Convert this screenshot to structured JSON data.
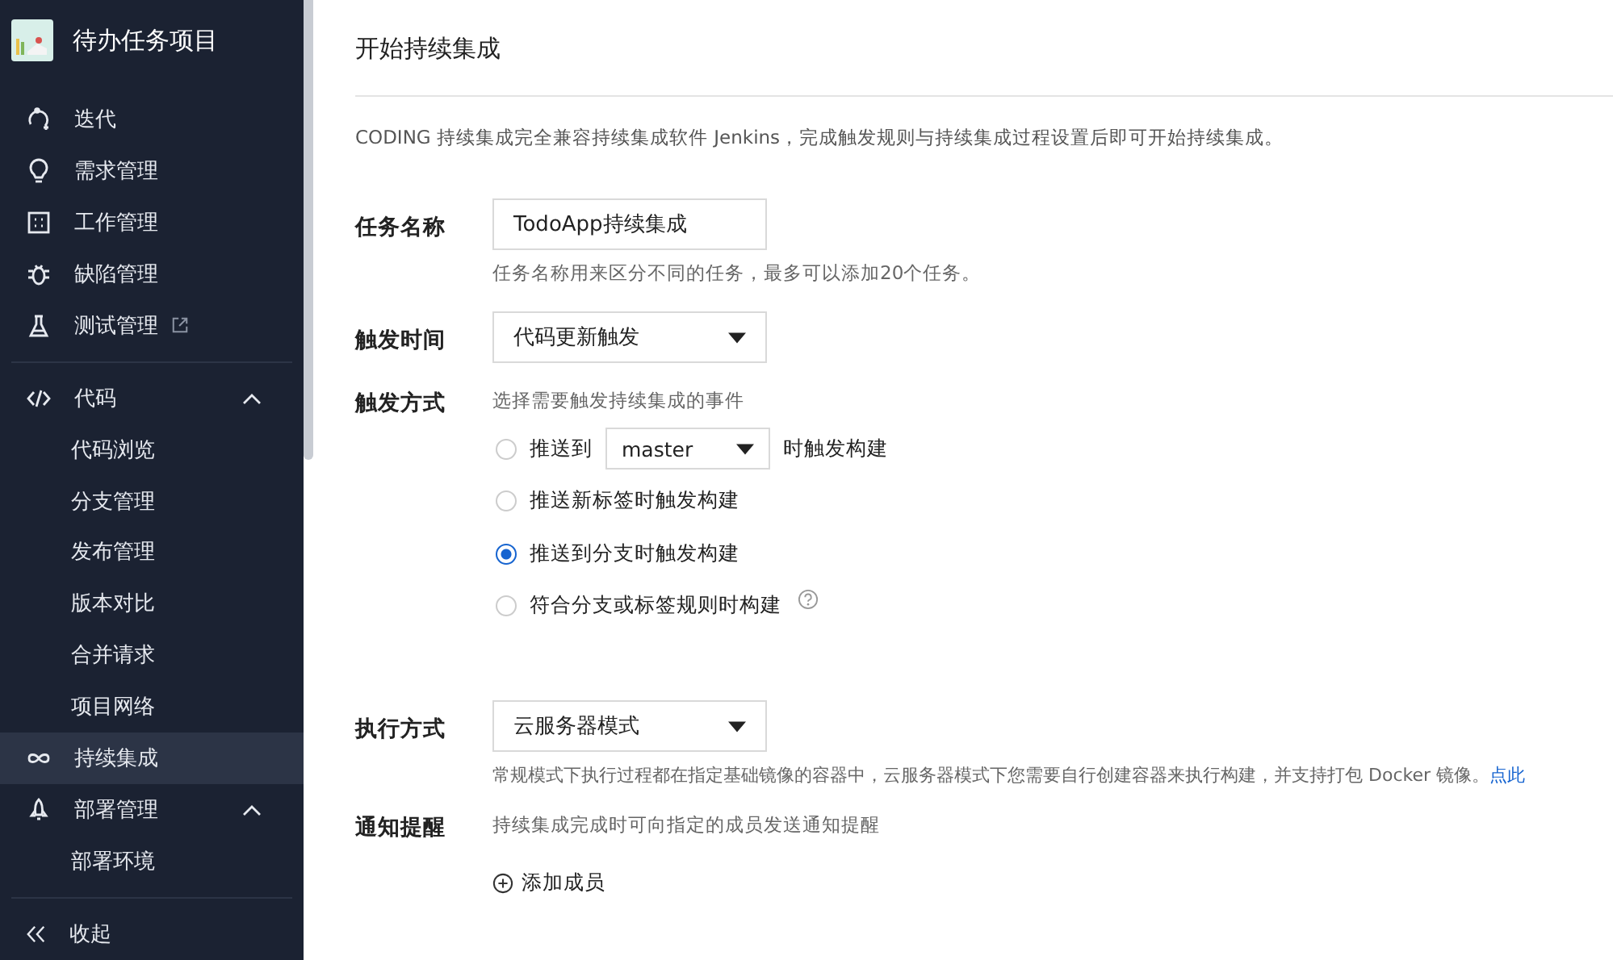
{
  "sidebar": {
    "project": "待办任务项目",
    "sections": [
      {
        "items": [
          {
            "label": "迭代",
            "selected": false
          },
          {
            "label": "需求管理",
            "selected": false
          },
          {
            "label": "工作管理",
            "selected": false
          },
          {
            "label": "缺陷管理",
            "selected": false
          },
          {
            "label": "测试管理",
            "selected": false,
            "external": true
          }
        ]
      },
      {
        "items": [
          {
            "label": "代码",
            "selected": false,
            "expanded": true,
            "children": [
              {
                "label": "代码浏览",
                "selected": false
              },
              {
                "label": "分支管理",
                "selected": false
              },
              {
                "label": "发布管理",
                "selected": false
              },
              {
                "label": "版本对比",
                "selected": false
              },
              {
                "label": "合并请求",
                "selected": false
              },
              {
                "label": "项目网络",
                "selected": false
              }
            ]
          },
          {
            "label": "持续集成",
            "selected": true
          },
          {
            "label": "部署管理",
            "selected": false,
            "expanded": true,
            "children": [
              {
                "label": "部署环境",
                "selected": false
              }
            ]
          }
        ]
      }
    ],
    "collapse": "收起"
  },
  "page": {
    "title": "开始持续集成",
    "description": "CODING 持续集成完全兼容持续集成软件 Jenkins，完成触发规则与持续集成过程设置后即可开始持续集成。",
    "fields": [
      {
        "kind": "input",
        "label": "任务名称",
        "value": "TodoApp持续集成",
        "hint": "任务名称用来区分不同的任务，最多可以添加20个任务。"
      },
      {
        "kind": "select",
        "label": "触发时间",
        "value": "代码更新触发"
      },
      {
        "kind": "radios",
        "label": "触发方式",
        "hint": "选择需要触发持续集成的事件",
        "options": [
          {
            "kind": "branch",
            "label": "推送到",
            "branch": "master",
            "suffix": "时触发构建",
            "selected": false
          },
          {
            "kind": "plain",
            "label": "推送新标签时触发构建",
            "selected": false
          },
          {
            "kind": "plain",
            "label": "推送到分支时触发构建",
            "selected": true
          },
          {
            "kind": "plain",
            "label": "符合分支或标签规则时构建",
            "selected": false,
            "help": true
          }
        ]
      },
      {
        "kind": "select",
        "label": "执行方式",
        "value": "云服务器模式",
        "hint": "常规模式下执行过程都在指定基础镜像的容器中，云服务器模式下您需要自行创建容器来执行构建，并支持打包 Docker 镜像。",
        "link": "点此"
      },
      {
        "kind": "members",
        "label": "通知提醒",
        "hint": "持续集成完成时可向指定的成员发送通知提醒",
        "action": "添加成员"
      }
    ]
  }
}
